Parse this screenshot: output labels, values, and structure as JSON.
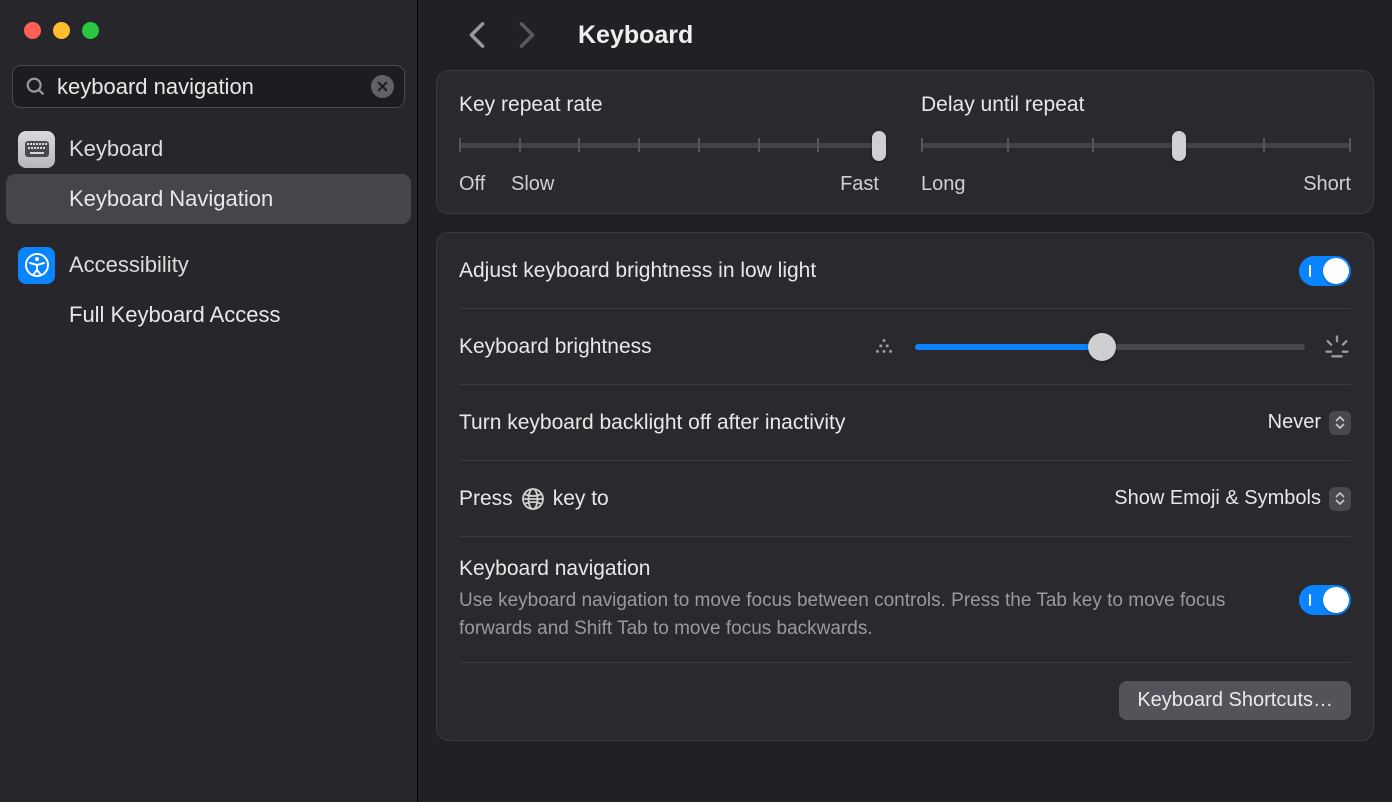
{
  "window": {
    "title": "Keyboard"
  },
  "search": {
    "value": "keyboard navigation"
  },
  "sidebar": {
    "groups": [
      {
        "title": "Keyboard",
        "sub": "Keyboard Navigation"
      },
      {
        "title": "Accessibility",
        "sub": "Full Keyboard Access"
      }
    ]
  },
  "panel1": {
    "key_repeat_label": "Key repeat rate",
    "key_repeat_scale": {
      "off": "Off",
      "slow": "Slow",
      "fast": "Fast"
    },
    "delay_label": "Delay until repeat",
    "delay_scale": {
      "long": "Long",
      "short": "Short"
    }
  },
  "panel2": {
    "auto_brightness_label": "Adjust keyboard brightness in low light",
    "brightness_label": "Keyboard brightness",
    "backlight_off_label": "Turn keyboard backlight off after inactivity",
    "backlight_off_value": "Never",
    "globe_label_pre": "Press",
    "globe_label_post": "key to",
    "globe_value": "Show Emoji & Symbols",
    "kb_nav_label": "Keyboard navigation",
    "kb_nav_desc": "Use keyboard navigation to move focus between controls. Press the Tab key to move focus forwards and Shift Tab to move focus backwards.",
    "shortcuts_btn": "Keyboard Shortcuts…"
  }
}
